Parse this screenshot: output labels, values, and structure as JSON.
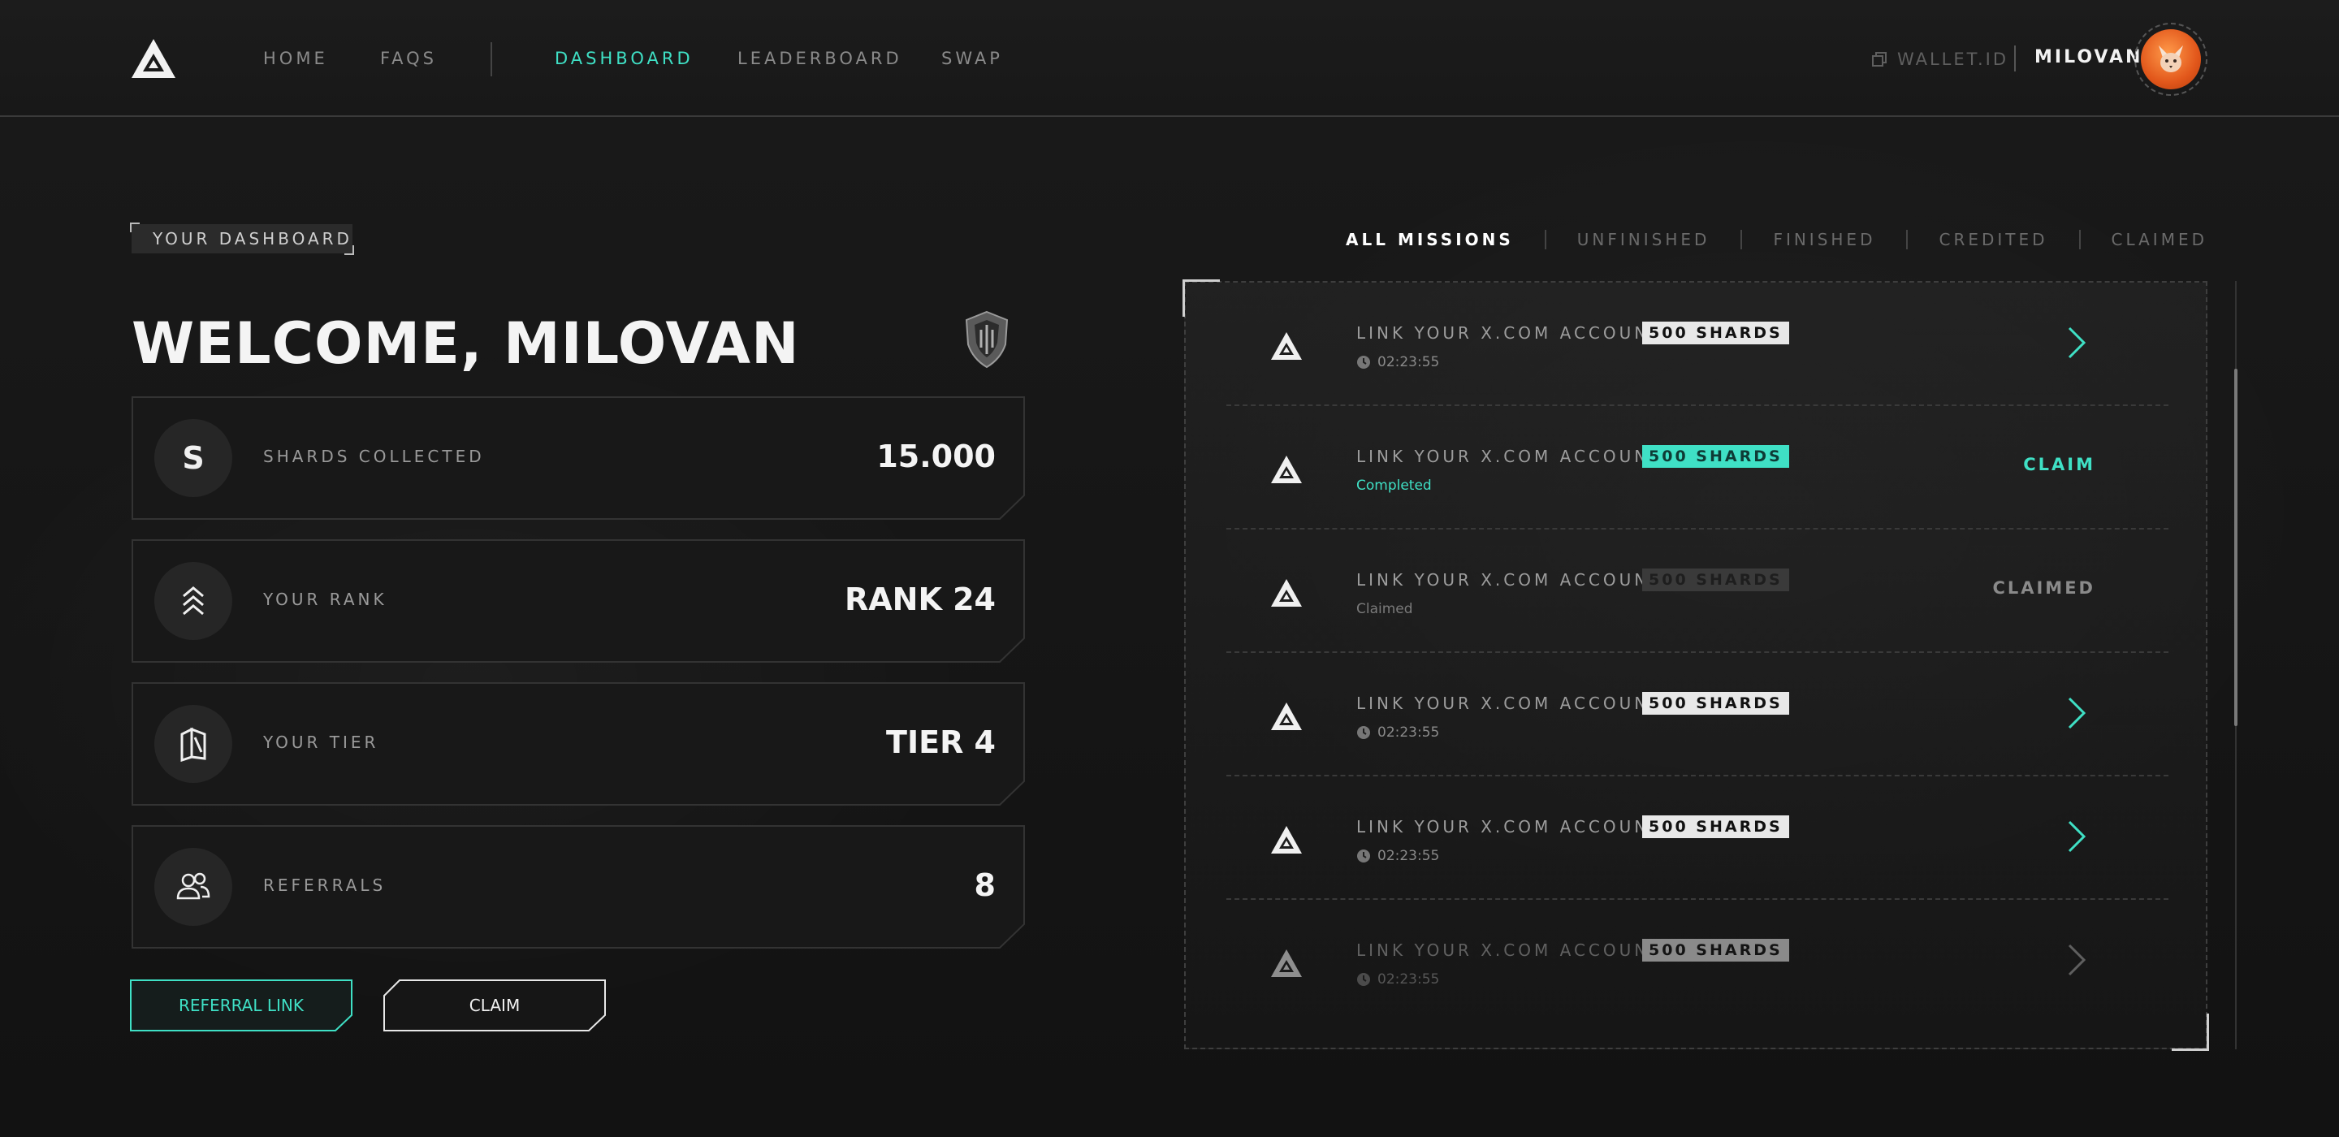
{
  "nav": {
    "links": [
      {
        "label": "HOME",
        "active": false
      },
      {
        "label": "FAQS",
        "active": false
      },
      {
        "label": "DASHBOARD",
        "active": true
      },
      {
        "label": "LEADERBOARD",
        "active": false
      },
      {
        "label": "SWAP",
        "active": false
      }
    ],
    "wallet_label": "WALLET.ID",
    "username": "MILOVAN",
    "avatar_icon": "fox-avatar-icon"
  },
  "dashboard": {
    "tag": "YOUR DASHBOARD",
    "welcome": "WELCOME, MILOVAN",
    "emblem_icon": "shield-emblem-icon",
    "stats": [
      {
        "icon": "S",
        "icon_name": "shards-icon",
        "label": "SHARDS COLLECTED",
        "value": "15.000"
      },
      {
        "icon": "",
        "icon_name": "rank-chevrons-icon",
        "label": "YOUR RANK",
        "value": "RANK 24"
      },
      {
        "icon": "",
        "icon_name": "tier-cube-icon",
        "label": "YOUR TIER",
        "value": "TIER 4"
      },
      {
        "icon": "",
        "icon_name": "users-icon",
        "label": "REFERRALS",
        "value": "8"
      }
    ],
    "buttons": {
      "referral_link": "REFERRAL LINK",
      "claim": "CLAIM"
    }
  },
  "missions": {
    "tabs": [
      {
        "label": "ALL MISSIONS",
        "active": true
      },
      {
        "label": "UNFINISHED",
        "active": false
      },
      {
        "label": "FINISHED",
        "active": false
      },
      {
        "label": "CREDITED",
        "active": false
      },
      {
        "label": "CLAIMED",
        "active": false
      }
    ],
    "items": [
      {
        "title": "LINK YOUR X.COM ACCOUNT",
        "badge": "500 SHARDS",
        "status": "open",
        "sub": "02:23:55",
        "action": ""
      },
      {
        "title": "LINK YOUR X.COM ACCOUNT",
        "badge": "500 SHARDS",
        "status": "completed",
        "sub": "Completed",
        "action": "CLAIM"
      },
      {
        "title": "LINK YOUR X.COM ACCOUNT",
        "badge": "500 SHARDS",
        "status": "claimed",
        "sub": "Claimed",
        "action": "CLAIMED"
      },
      {
        "title": "LINK YOUR X.COM ACCOUNT",
        "badge": "500 SHARDS",
        "status": "open",
        "sub": "02:23:55",
        "action": ""
      },
      {
        "title": "LINK YOUR X.COM ACCOUNT",
        "badge": "500 SHARDS",
        "status": "open",
        "sub": "02:23:55",
        "action": ""
      },
      {
        "title": "LINK YOUR X.COM ACCOUNT",
        "badge": "500 SHARDS",
        "status": "open",
        "sub": "02:23:55",
        "action": ""
      }
    ]
  },
  "colors": {
    "accent": "#3fe0c5",
    "background": "#141414",
    "text": "#e8e8e8",
    "muted": "#8a8a8a"
  }
}
